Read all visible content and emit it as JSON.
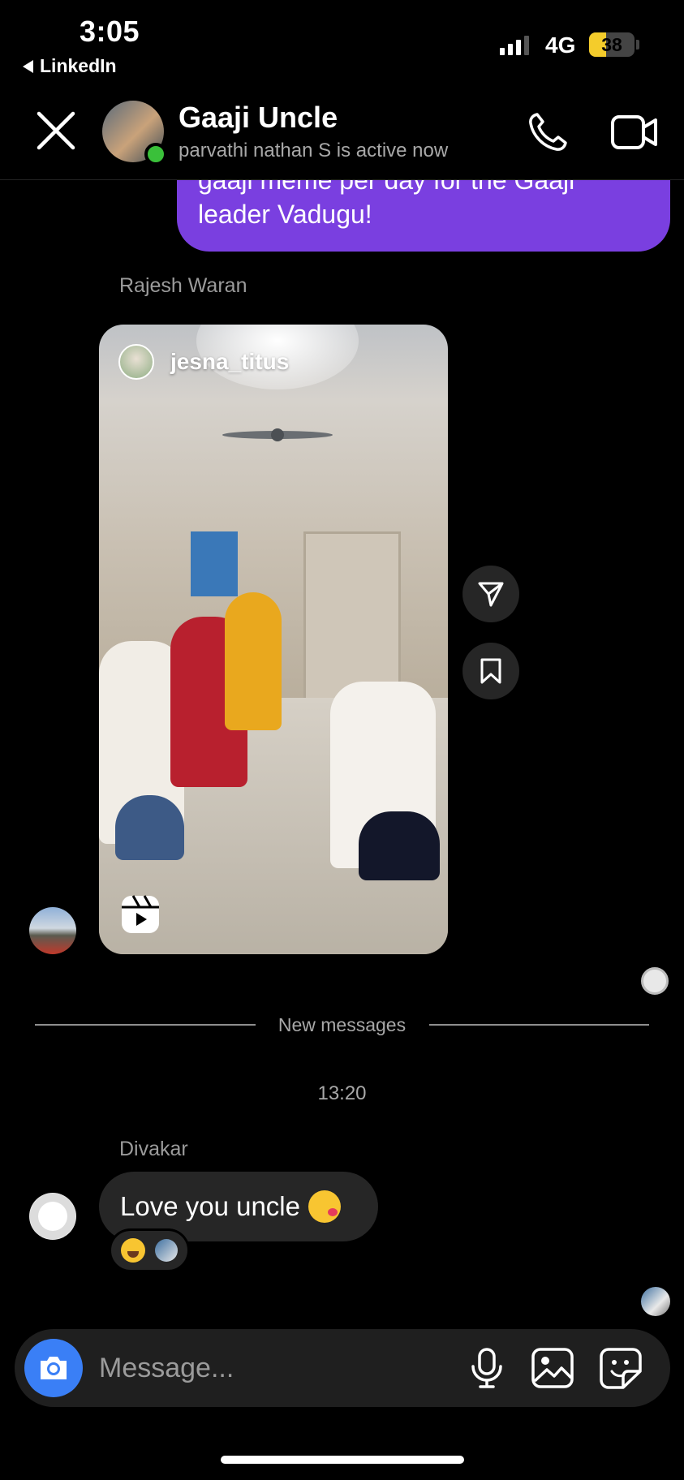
{
  "status_bar": {
    "time": "3:05",
    "back_app": "LinkedIn",
    "network": "4G",
    "battery": "38",
    "battery_level": 0.38
  },
  "header": {
    "contact_name": "Gaaji Uncle",
    "active_status": "parvathi nathan S is active now"
  },
  "conversation": {
    "sent_message_lines": [
      "gaaji meme per day for the Gaaji",
      "leader Vadugu!"
    ],
    "shared_reel": {
      "sender": "Rajesh Waran",
      "owner": "jesna_titus"
    },
    "divider_label": "New messages",
    "timestamp": "13:20",
    "received_message": {
      "sender": "Divakar",
      "text": "Love you uncle",
      "emoji": "kissing-face-heart",
      "reactions": [
        "face-with-tears-of-joy",
        "user-avatar"
      ]
    }
  },
  "composer": {
    "placeholder": "Message..."
  },
  "colors": {
    "background": "#000000",
    "sent_bubble": "#7a3fe0",
    "received_bubble": "#262626",
    "camera_button": "#3a7ff6",
    "online_dot": "#3ac03a",
    "battery_fill": "#f4cc2b"
  }
}
